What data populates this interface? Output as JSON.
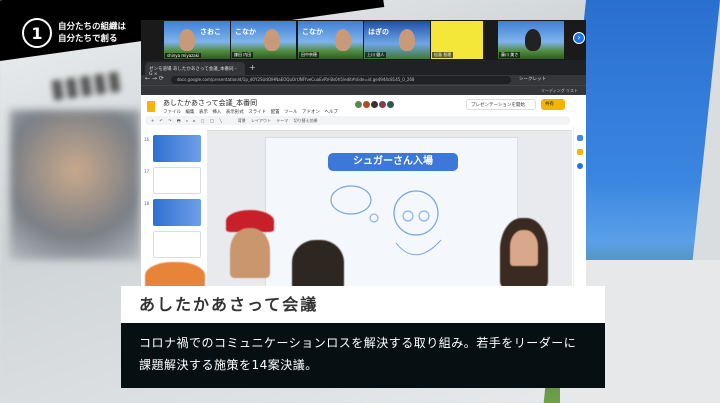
{
  "badge": {
    "number": "1",
    "line1": "自分たちの組織は",
    "line2": "自分たちで創る"
  },
  "meeting": {
    "participants": [
      {
        "name": "shinya miyazaki",
        "label": "さおこ"
      },
      {
        "name": "鎌田 内田",
        "label": "こなか"
      },
      {
        "name": "田中奈穂",
        "label": "こなか"
      },
      {
        "name": "上川 健人",
        "label": "はぎの"
      },
      {
        "name": "松島 担理",
        "label": ""
      },
      {
        "name": "藤川 美さ",
        "label": ""
      }
    ],
    "next_icon": "chevron-right-icon"
  },
  "browser": {
    "tab_prefix": "ゼンモ道場",
    "tab_title": "あしたかあさって会議_本番同 - G",
    "url": "docs.google.com/presentation/d/1p_d0Y2SUdOlHNaEOQuOrUNFfveCuaEvRV-Bs0h5/edit#slide=id.ge4944c8145_0_268",
    "incognito": "シークレット",
    "reading_list": "リーディング リスト"
  },
  "slides": {
    "doc_title": "あしたかあさって会議_本番同",
    "menu": [
      "ファイル",
      "編集",
      "表示",
      "挿入",
      "表示形式",
      "スライド",
      "配置",
      "ツール",
      "アドオン",
      "ヘルプ"
    ],
    "present_label": "プレゼンテーションを開始",
    "share_label": "共有",
    "toolbar": [
      "背景",
      "レイアウト",
      "テーマ",
      "切り替え効果"
    ],
    "slide_numbers": [
      "16",
      "17",
      "18"
    ],
    "slide_button": "シュガーさん入場"
  },
  "caption": {
    "title": "あしたかあさって会議",
    "body": "コロナ禍でのコミュニケーションロスを解決する取り組み。若手をリーダーに課題解決する施策を14案決議。"
  },
  "colors": {
    "accent": "#3b78d8",
    "share": "#f4b400",
    "caption_bg": "#061013"
  }
}
